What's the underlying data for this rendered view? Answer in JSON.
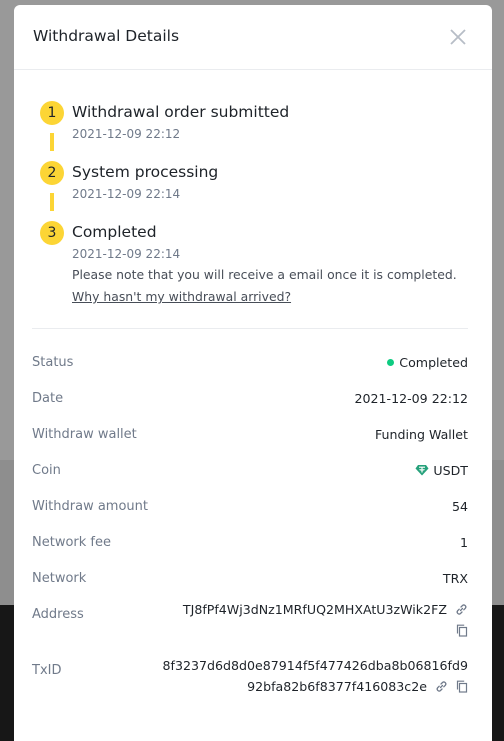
{
  "modal": {
    "title": "Withdrawal Details"
  },
  "steps": [
    {
      "number": "1",
      "title": "Withdrawal order submitted",
      "time": "2021-12-09 22:12"
    },
    {
      "number": "2",
      "title": "System processing",
      "time": "2021-12-09 22:14"
    },
    {
      "number": "3",
      "title": "Completed",
      "time": "2021-12-09 22:14",
      "note": "Please note that you will receive a email once it is completed.",
      "link": "Why hasn't my withdrawal arrived?"
    }
  ],
  "details": {
    "status": {
      "label": "Status",
      "value": "Completed"
    },
    "date": {
      "label": "Date",
      "value": "2021-12-09 22:12"
    },
    "wallet": {
      "label": "Withdraw wallet",
      "value": "Funding Wallet"
    },
    "coin": {
      "label": "Coin",
      "value": "USDT"
    },
    "amount": {
      "label": "Withdraw amount",
      "value": "54"
    },
    "fee": {
      "label": "Network fee",
      "value": "1"
    },
    "network": {
      "label": "Network",
      "value": "TRX"
    },
    "address": {
      "label": "Address",
      "value": "TJ8fPf4Wj3dNz1MRfUQ2MHXAtU3zWik2FZ"
    },
    "txid": {
      "label": "TxID",
      "line1": "8f3237d6d8d0e87914f5f477426dba8b06816fd9",
      "line2": "92bfa82b6f8377f416083c2e"
    }
  },
  "colors": {
    "accent": "#fcd535",
    "success": "#0ecb81",
    "usdt": "#26a17b"
  }
}
